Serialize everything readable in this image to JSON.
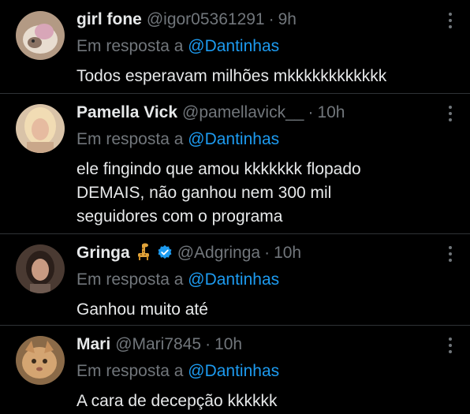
{
  "replies": [
    {
      "name": "girl fone",
      "handle": "@igor05361291",
      "time": "9h",
      "reply_prefix": "Em resposta a",
      "reply_to": "@Dantinhas",
      "text": "Todos esperavam milhões mkkkkkkkkkkkk",
      "avatar_icon": "photo-avatar",
      "verified": false
    },
    {
      "name": "Pamella Vick",
      "handle": "@pamellavick__",
      "time": "10h",
      "reply_prefix": "Em resposta a",
      "reply_to": "@Dantinhas",
      "text": "ele fingindo que amou kkkkkkk flopado\nDEMAIS, não ganhou nem 300 mil\nseguidores com o programa",
      "avatar_icon": "photo-avatar",
      "verified": false
    },
    {
      "name": "Gringa",
      "name_emoji": "giraffe-emoji",
      "handle": "@Adgringa",
      "time": "10h",
      "reply_prefix": "Em resposta a",
      "reply_to": "@Dantinhas",
      "text": "Ganhou muito até",
      "avatar_icon": "photo-avatar",
      "verified": true,
      "verified_icon": "verified-badge-icon"
    },
    {
      "name": "Mari",
      "handle": "@Mari7845",
      "time": "10h",
      "reply_prefix": "Em resposta a",
      "reply_to": "@Dantinhas",
      "text": "A cara de decepção kkkkkk",
      "avatar_icon": "photo-avatar",
      "verified": false
    }
  ],
  "separator": "·",
  "more_icon": "more-options-icon",
  "colors": {
    "background": "#000000",
    "text": "#e7e9ea",
    "secondary": "#71767b",
    "accent": "#1d9bf0",
    "divider": "#2f3336"
  }
}
